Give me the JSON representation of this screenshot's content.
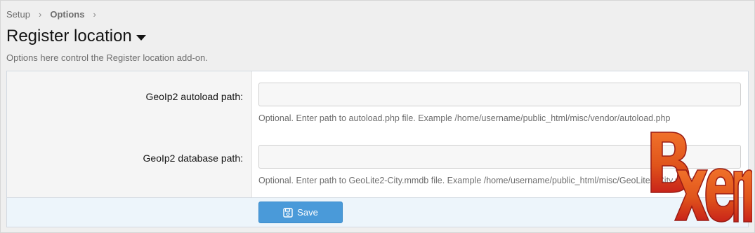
{
  "breadcrumb": {
    "items": [
      "Setup",
      "Options"
    ],
    "separator": "›"
  },
  "header": {
    "title": "Register location"
  },
  "description": "Options here control the Register location add-on.",
  "form": {
    "fields": [
      {
        "label": "GeoIp2 autoload path:",
        "value": "",
        "hint": "Optional. Enter path to autoload.php file. Example /home/username/public_html/misc/vendor/autoload.php"
      },
      {
        "label": "GeoIp2 database path:",
        "value": "",
        "hint": "Optional. Enter path to GeoLite2-City.mmdb file. Example /home/username/public_html/misc/GeoLite2-City.mmdb"
      }
    ],
    "save_label": "Save"
  },
  "watermark": {
    "text": "Bxen",
    "color": "#e0541b"
  },
  "colors": {
    "accent": "#4a9ad9",
    "submit_row_bg": "#edf5fb",
    "page_bg": "#efefef"
  }
}
